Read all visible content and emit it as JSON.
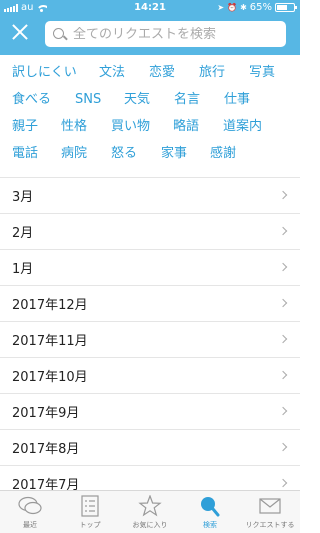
{
  "status_bar": {
    "carrier": "au",
    "time": "14:21",
    "battery": "65%",
    "battery_level": 0.65
  },
  "search": {
    "placeholder": "全てのリクエストを検索"
  },
  "tags": [
    [
      "訳しにくい",
      "文法",
      "恋愛",
      "旅行",
      "写真"
    ],
    [
      "食べる",
      "SNS",
      "天気",
      "名言",
      "仕事"
    ],
    [
      "親子",
      "性格",
      "買い物",
      "略語",
      "道案内"
    ],
    [
      "電話",
      "病院",
      "怒る",
      "家事",
      "感謝"
    ]
  ],
  "months": [
    "3月",
    "2月",
    "1月",
    "2017年12月",
    "2017年11月",
    "2017年10月",
    "2017年9月",
    "2017年8月",
    "2017年7月"
  ],
  "tabbar": {
    "items": [
      {
        "label": "最近",
        "icon": "chat-bubbles-icon"
      },
      {
        "label": "トップ",
        "icon": "list-icon"
      },
      {
        "label": "お気に入り",
        "icon": "star-icon"
      },
      {
        "label": "検索",
        "icon": "search-icon"
      },
      {
        "label": "リクエストする",
        "icon": "envelope-icon"
      }
    ],
    "active_index": 3
  },
  "colors": {
    "header": "#57b7e4",
    "accent": "#2f9fd8"
  }
}
